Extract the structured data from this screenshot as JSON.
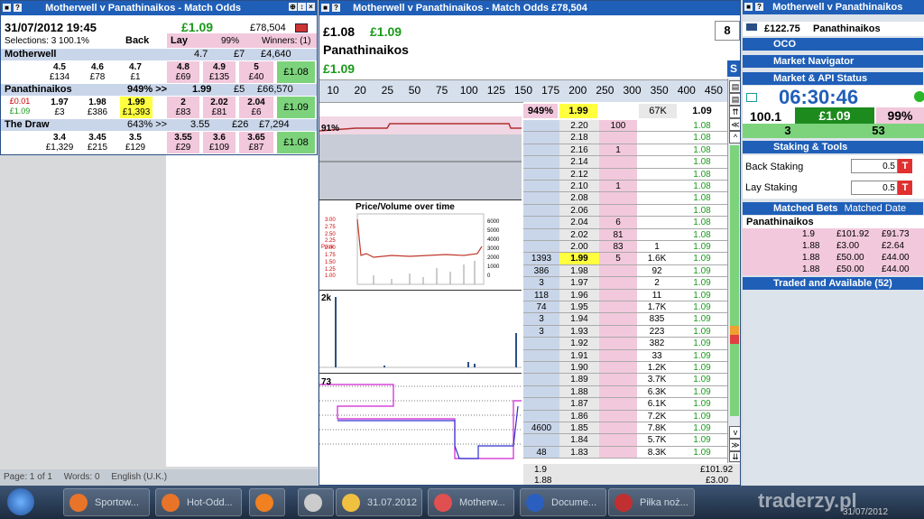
{
  "left_panel": {
    "title": "Motherwell v Panathinaikos - Match Odds",
    "date": "31/07/2012  19:45",
    "matched": "£1.09",
    "total": "£78,504",
    "selections": "Selections: 3  100.1%",
    "back_label": "Back",
    "lay_label": "Lay",
    "lay_pct": "99%",
    "winners": "Winners: (1)",
    "runners": [
      {
        "name": "Motherwell",
        "s1": "4.7",
        "s2": "£7",
        "s3": "£4,640",
        "back": [
          {
            "p": "4.5",
            "v": "£134"
          },
          {
            "p": "4.6",
            "v": "£78"
          },
          {
            "p": "4.7",
            "v": "£1"
          }
        ],
        "lay": [
          {
            "p": "4.8",
            "v": "£69"
          },
          {
            "p": "4.9",
            "v": "£135"
          },
          {
            "p": "5",
            "v": "£40"
          }
        ],
        "stake": "£1.08"
      },
      {
        "name": "Panathinaikos",
        "s1": "949% >>",
        "s2": "1.99",
        "s3": "£5",
        "s4": "£66,570",
        "pl1": "£0.01",
        "pl2": "£1.09",
        "back": [
          {
            "p": "1.97",
            "v": "£3"
          },
          {
            "p": "1.98",
            "v": "£386"
          },
          {
            "p": "1.99",
            "v": "£1,393"
          }
        ],
        "lay": [
          {
            "p": "2",
            "v": "£83"
          },
          {
            "p": "2.02",
            "v": "£81"
          },
          {
            "p": "2.04",
            "v": "£6"
          }
        ],
        "stake": "£1.09"
      },
      {
        "name": "The Draw",
        "s1": "643% >>",
        "s2": "3.55",
        "s3": "£26",
        "s4": "£7,294",
        "back": [
          {
            "p": "3.4",
            "v": "£1,329"
          },
          {
            "p": "3.45",
            "v": "£215"
          },
          {
            "p": "3.5",
            "v": "£129"
          }
        ],
        "lay": [
          {
            "p": "3.55",
            "v": "£29"
          },
          {
            "p": "3.6",
            "v": "£109"
          },
          {
            "p": "3.65",
            "v": "£87"
          }
        ],
        "stake": "£1.08"
      }
    ]
  },
  "status": {
    "page": "Page: 1 of 1",
    "words": "Words: 0",
    "lang": "English (U.K.)"
  },
  "ladder": {
    "title": "Motherwell v Panathinaikos - Match Odds  £78,504",
    "pl_back": "£1.08",
    "pl_lay": "£1.09",
    "runner": "Panathinaikos",
    "runner_pl": "£1.09",
    "number": "8",
    "s_btn": "S",
    "stakes": [
      "10",
      "20",
      "25",
      "50",
      "75",
      "100",
      "125",
      "150",
      "175",
      "200",
      "250",
      "300",
      "350",
      "400",
      "450"
    ],
    "header": {
      "pct": "949%",
      "ltp": "1.99",
      "vol": "67K",
      "pl": "1.09"
    },
    "chart_title": "Price/Volume over time",
    "chart_y_left": [
      "3.00",
      "2.75",
      "2.50",
      "2.25",
      "2.00",
      "1.75",
      "1.50",
      "1.25",
      "1.00"
    ],
    "chart_y_right": [
      "6000",
      "5000",
      "4000",
      "3000",
      "2000",
      "1000",
      "0"
    ],
    "chart_ylabel": "Price",
    "graph1_label": "91%",
    "graph2_label": "2k",
    "graph3_label": "73",
    "rows": [
      {
        "back": "",
        "price": "2.20",
        "lay": "100",
        "vol": "",
        "pl": "1.08"
      },
      {
        "back": "",
        "price": "2.18",
        "lay": "",
        "vol": "",
        "pl": "1.08"
      },
      {
        "back": "",
        "price": "2.16",
        "lay": "1",
        "vol": "",
        "pl": "1.08"
      },
      {
        "back": "",
        "price": "2.14",
        "lay": "",
        "vol": "",
        "pl": "1.08"
      },
      {
        "back": "",
        "price": "2.12",
        "lay": "",
        "vol": "",
        "pl": "1.08"
      },
      {
        "back": "",
        "price": "2.10",
        "lay": "1",
        "vol": "",
        "pl": "1.08"
      },
      {
        "back": "",
        "price": "2.08",
        "lay": "",
        "vol": "",
        "pl": "1.08"
      },
      {
        "back": "",
        "price": "2.06",
        "lay": "",
        "vol": "",
        "pl": "1.08"
      },
      {
        "back": "",
        "price": "2.04",
        "lay": "6",
        "vol": "",
        "pl": "1.08"
      },
      {
        "back": "",
        "price": "2.02",
        "lay": "81",
        "vol": "",
        "pl": "1.08"
      },
      {
        "back": "",
        "price": "2.00",
        "lay": "83",
        "vol": "1",
        "pl": "1.09"
      },
      {
        "back": "1393",
        "price": "1.99",
        "lay": "5",
        "vol": "1.6K",
        "pl": "1.09"
      },
      {
        "back": "386",
        "price": "1.98",
        "lay": "",
        "vol": "92",
        "pl": "1.09"
      },
      {
        "back": "3",
        "price": "1.97",
        "lay": "",
        "vol": "2",
        "pl": "1.09"
      },
      {
        "back": "118",
        "price": "1.96",
        "lay": "",
        "vol": "11",
        "pl": "1.09"
      },
      {
        "back": "74",
        "price": "1.95",
        "lay": "",
        "vol": "1.7K",
        "pl": "1.09"
      },
      {
        "back": "3",
        "price": "1.94",
        "lay": "",
        "vol": "835",
        "pl": "1.09"
      },
      {
        "back": "3",
        "price": "1.93",
        "lay": "",
        "vol": "223",
        "pl": "1.09"
      },
      {
        "back": "",
        "price": "1.92",
        "lay": "",
        "vol": "382",
        "pl": "1.09"
      },
      {
        "back": "",
        "price": "1.91",
        "lay": "",
        "vol": "33",
        "pl": "1.09"
      },
      {
        "back": "",
        "price": "1.90",
        "lay": "",
        "vol": "1.2K",
        "pl": "1.09"
      },
      {
        "back": "",
        "price": "1.89",
        "lay": "",
        "vol": "3.7K",
        "pl": "1.09"
      },
      {
        "back": "",
        "price": "1.88",
        "lay": "",
        "vol": "6.3K",
        "pl": "1.09"
      },
      {
        "back": "",
        "price": "1.87",
        "lay": "",
        "vol": "6.1K",
        "pl": "1.09"
      },
      {
        "back": "",
        "price": "1.86",
        "lay": "",
        "vol": "7.2K",
        "pl": "1.09"
      },
      {
        "back": "4600",
        "price": "1.85",
        "lay": "",
        "vol": "7.8K",
        "pl": "1.09"
      },
      {
        "back": "",
        "price": "1.84",
        "lay": "",
        "vol": "5.7K",
        "pl": "1.09"
      },
      {
        "back": "48",
        "price": "1.83",
        "lay": "",
        "vol": "8.3K",
        "pl": "1.09"
      }
    ],
    "footer": [
      {
        "a": "1.9",
        "b": "£101.92"
      },
      {
        "a": "1.88",
        "b": "£3.00"
      }
    ]
  },
  "right_panel": {
    "title": "Motherwell v Panathinaikos",
    "balance": "£122.75",
    "balance_runner": "Panathinaikos",
    "oco": "OCO",
    "market_nav": "Market Navigator",
    "api_status": "Market & API Status",
    "clock": "06:30:46",
    "book_back": "100.1",
    "book_pl": "£1.09",
    "book_lay": "99%",
    "count_back": "3",
    "count_lay": "53",
    "staking_tools": "Staking & Tools",
    "back_staking": "Back Staking",
    "back_staking_val": "0.5",
    "lay_staking": "Lay Staking",
    "lay_staking_val": "0.5",
    "t_label": "T",
    "matched_bets": "Matched Bets",
    "matched_date": "Matched Date",
    "bets_runner": "Panathinaikos",
    "bets": [
      {
        "odds": "1.9",
        "stake": "£101.92",
        "ret": "£91.73"
      },
      {
        "odds": "1.88",
        "stake": "£3.00",
        "ret": "£2.64"
      },
      {
        "odds": "1.88",
        "stake": "£50.00",
        "ret": "£44.00"
      },
      {
        "odds": "1.88",
        "stake": "£50.00",
        "ret": "£44.00"
      }
    ],
    "traded": "Traded and Available (52)"
  },
  "taskbar": {
    "items": [
      "Sportow...",
      "Hot-Odd...",
      "",
      "",
      "31.07.2012",
      "Motherw...",
      "Docume...",
      "Piłka noż..."
    ],
    "watermark": "traderzy.pl",
    "date": "31/07/2012"
  }
}
